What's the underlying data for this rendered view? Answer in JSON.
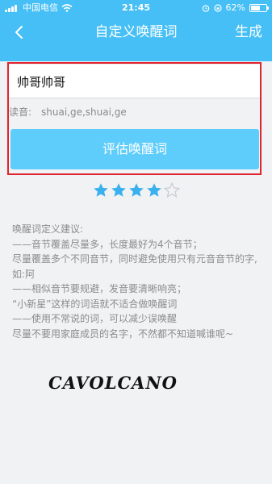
{
  "status_bar": {
    "carrier": "中国电信",
    "time": "21:45",
    "battery": "62%",
    "battery_level": 0.62
  },
  "nav": {
    "title": "自定义唤醒词",
    "action_label": "生成",
    "back_icon": "chevron-left-icon"
  },
  "form": {
    "wake_word_value": "帅哥帅哥",
    "pronunciation_label": "读音:",
    "pronunciation_value": "shuai,ge,shuai,ge",
    "evaluate_label": "评估唤醒词"
  },
  "rating": {
    "value": 4,
    "max": 5,
    "filled_color": "#3ab0ee",
    "empty_color": "#c9cdd2"
  },
  "tips": {
    "title": "唤醒词定义建议:",
    "lines": [
      "——音节覆盖尽量多，长度最好为4个音节；",
      "尽量覆盖多个不同音节，同时避免使用只有元音音节的字,如:阿",
      "——相似音节要规避，发音要清晰响亮；",
      "“小新星”这样的词语就不适合做唤醒词",
      "——使用不常说的词，可以减少误唤醒",
      "尽量不要用家庭成员的名字，不然都不知道喊谁呢~"
    ]
  },
  "watermark": "CAVOLCANO",
  "colors": {
    "header": "#45bff5",
    "button": "#5fcdfb",
    "highlight": "#e0232e"
  }
}
